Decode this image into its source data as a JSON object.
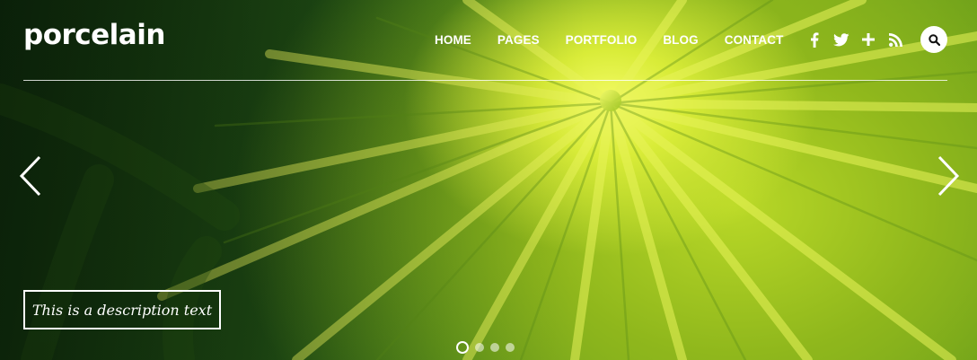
{
  "header": {
    "logo": "porcelain",
    "nav": [
      "HOME",
      "PAGES",
      "PORTFOLIO",
      "BLOG",
      "CONTACT"
    ],
    "social_icons": [
      "facebook-icon",
      "twitter-icon",
      "google-plus-icon",
      "rss-icon"
    ],
    "search_icon": "search-icon"
  },
  "slider": {
    "caption": "This is a description text",
    "prev_icon": "chevron-left-icon",
    "next_icon": "chevron-right-icon",
    "slide_count": 4,
    "active_slide": 1
  },
  "colors": {
    "text": "#ffffff",
    "leaf_highlight": "#e8f34a",
    "leaf_dark": "#1d3a12"
  }
}
